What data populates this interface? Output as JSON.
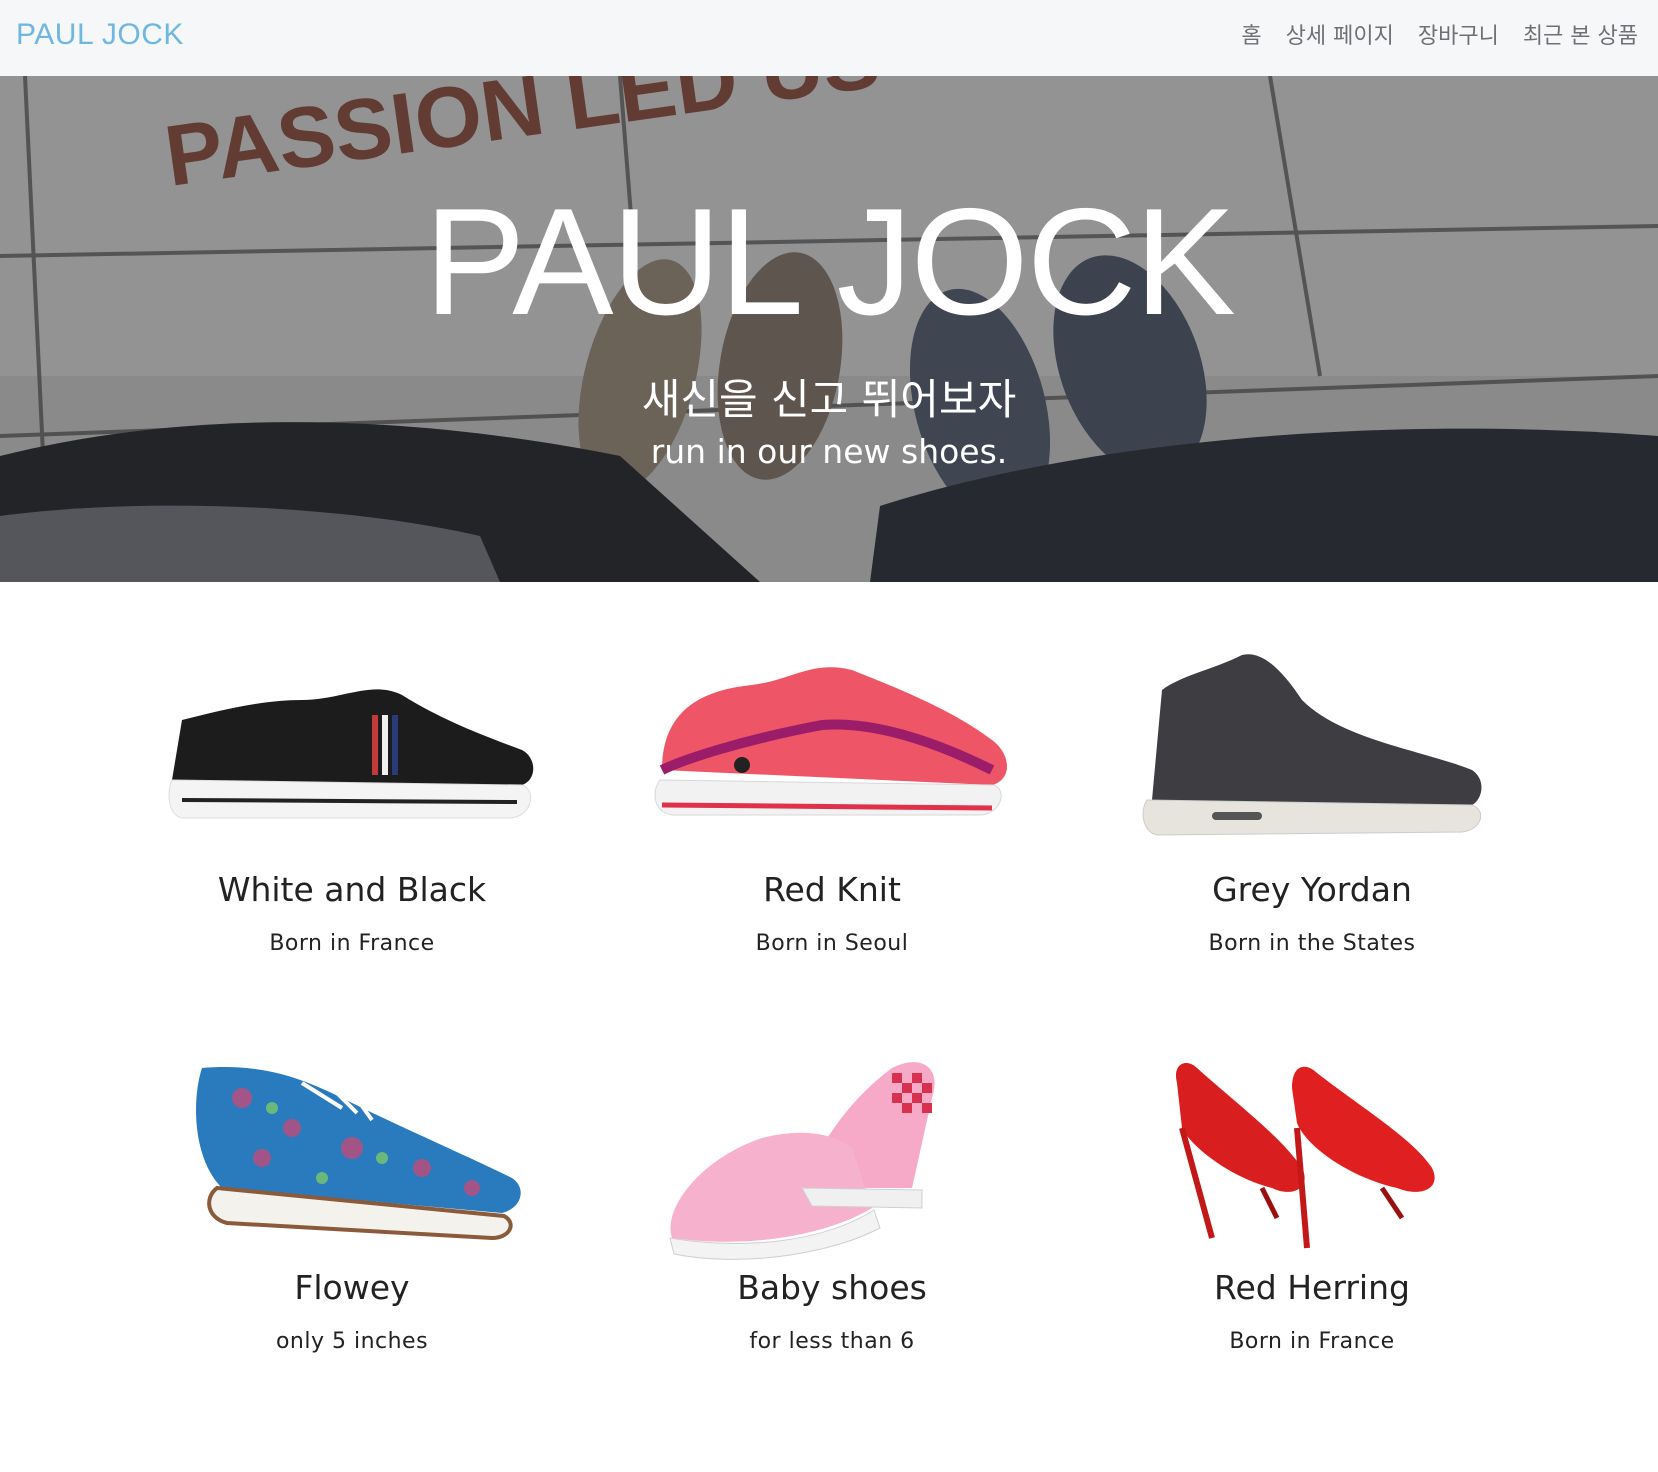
{
  "navbar": {
    "brand": "PAUL JOCK",
    "links": [
      "홈",
      "상세 페이지",
      "장바구니",
      "최근 본 상품"
    ]
  },
  "hero": {
    "title": "PAUL JOCK",
    "subtitle_ko": "새신을 신고 뛰어보자",
    "subtitle_en": "run in our new shoes.",
    "painted_text": "PASSION LED US"
  },
  "products": [
    {
      "name": "White and Black",
      "desc": "Born in France",
      "image": "black-sneaker"
    },
    {
      "name": "Red Knit",
      "desc": "Born in Seoul",
      "image": "red-running-shoe"
    },
    {
      "name": "Grey Yordan",
      "desc": "Born in the States",
      "image": "grey-high-top"
    },
    {
      "name": "Flowey",
      "desc": "only 5 inches",
      "image": "floral-oxford"
    },
    {
      "name": "Baby shoes",
      "desc": "for less than 6",
      "image": "pink-slip-on"
    },
    {
      "name": "Red Herring",
      "desc": "Born in France",
      "image": "red-heels"
    }
  ],
  "colors": {
    "brand": "#6fb6e0",
    "navbar_bg": "#f6f7f8",
    "nav_link": "#6d7175",
    "text": "#222222"
  }
}
